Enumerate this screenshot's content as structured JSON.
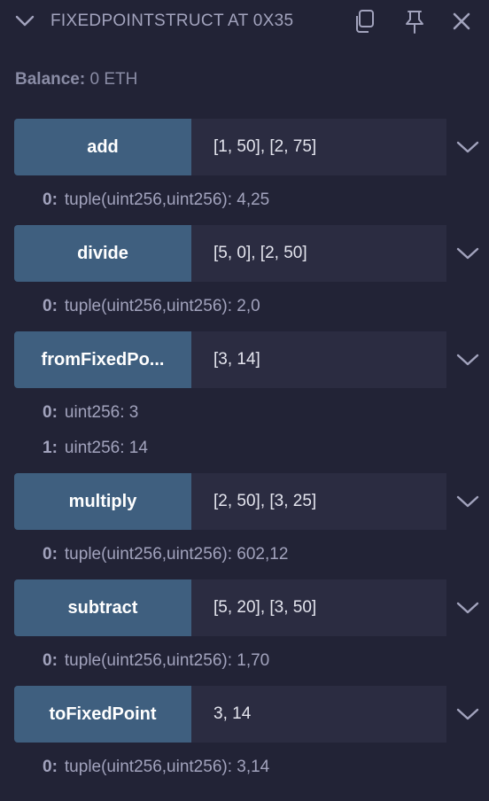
{
  "header": {
    "title": "FIXEDPOINTSTRUCT AT 0X35",
    "icons": {
      "collapse": "chevron-down-icon",
      "copy": "copy-icon",
      "pin": "pin-icon",
      "close": "close-icon"
    }
  },
  "balance": {
    "label": "Balance:",
    "value": "0 ETH"
  },
  "functions": [
    {
      "name": "add",
      "input": "[1, 50], [2, 75]",
      "outputs": [
        {
          "index": "0:",
          "value": "tuple(uint256,uint256): 4,25"
        }
      ]
    },
    {
      "name": "divide",
      "input": "[5, 0], [2, 50]",
      "outputs": [
        {
          "index": "0:",
          "value": "tuple(uint256,uint256): 2,0"
        }
      ]
    },
    {
      "name": "fromFixedPo...",
      "input": "[3, 14]",
      "outputs": [
        {
          "index": "0:",
          "value": "uint256: 3"
        },
        {
          "index": "1:",
          "value": "uint256: 14"
        }
      ]
    },
    {
      "name": "multiply",
      "input": "[2, 50], [3, 25]",
      "outputs": [
        {
          "index": "0:",
          "value": "tuple(uint256,uint256): 602,12"
        }
      ]
    },
    {
      "name": "subtract",
      "input": "[5, 20], [3, 50]",
      "outputs": [
        {
          "index": "0:",
          "value": "tuple(uint256,uint256): 1,70"
        }
      ]
    },
    {
      "name": "toFixedPoint",
      "input": "3, 14",
      "outputs": [
        {
          "index": "0:",
          "value": "tuple(uint256,uint256): 3,14"
        }
      ]
    }
  ],
  "colors": {
    "background": "#222336",
    "button": "#3f5f7f",
    "input": "#2b2c41",
    "text": "#a2a3bd"
  }
}
